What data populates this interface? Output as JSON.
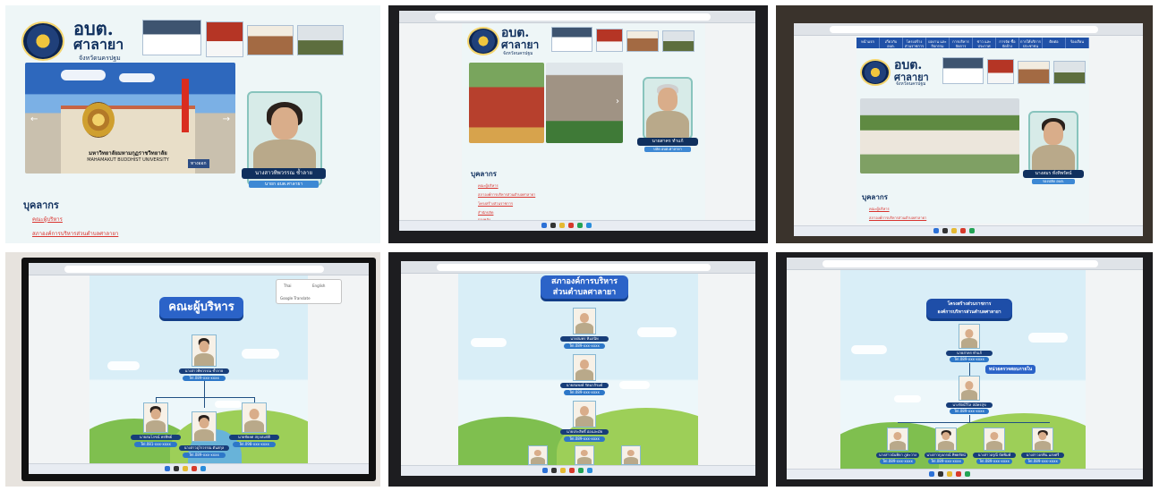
{
  "panels": {
    "p1": {
      "brand_main": "อบต.",
      "brand_name": "ศาลายา",
      "brand_sub": "จังหวัดนครปฐม",
      "university_sign": "มหาวิทยาลัยมหามกุฏราชวิทยาลัย",
      "university_sign_en": "MAHAMAKUT BUDDHIST UNIVERSITY",
      "profile_name": "นางสาวทิพวรรณ ช้ำลาย",
      "profile_role": "นายก อบต.ศาลายา",
      "section_title": "บุคลากร",
      "links": [
        "คณะผู้บริหาร",
        "สภาองค์การบริหารส่วนตำบลศาลายา"
      ],
      "next_arrow": "→",
      "prev_arrow": "←",
      "sign_small": "ทางออก"
    },
    "p2": {
      "brand_main": "อบต.",
      "brand_name": "ศาลายา",
      "brand_sub": "จังหวัดนครปฐม",
      "profile_name": "นายสาคร ทำแก้",
      "profile_role": "ปลัด อบต.ศาลายา",
      "section_title": "บุคลากร",
      "links": [
        "คณะผู้บริหาร",
        "สภาองค์การบริหารส่วนตำบลศาลายา",
        "โครงสร้างส่วนราชการ",
        "สำนักปลัด",
        "กองคลัง"
      ],
      "next_arrow": "›"
    },
    "p3": {
      "brand_main": "อบต.",
      "brand_name": "ศาลายา",
      "brand_sub": "จังหวัดนครปฐม",
      "nav": [
        "หน้าแรก",
        "เกี่ยวกับ อบต.",
        "โครงสร้าง ส่วนราชการ",
        "ผลงาน และ กิจกรรม",
        "การบริหาร จัดการ",
        "ข่าว และ ประกาศ",
        "การจัด ซื้อจัดจ้าง",
        "การให้บริการ ประชาชน",
        "ติดต่อ",
        "ร้องเรียน"
      ],
      "profile_name": "นางสมร ทั่งทิพรัตน์",
      "profile_role": "รองปลัด อบต.",
      "section_title": "บุคลากร",
      "links": [
        "คณะผู้บริหาร",
        "สภาองค์การบริหารส่วนตำบลศาลายา"
      ]
    },
    "p4": {
      "title": "คณะผู้บริหาร",
      "popup_options": [
        "Thai",
        "English"
      ],
      "popup_footer": "Google Translate",
      "top_name": "นางสาวทิพวรรณ ช้ำลาย",
      "top_phone": "Tel.089-xxx-xxxx",
      "members": [
        {
          "name": "นายสมโภชน์ พรทิพย์",
          "phone": "Tel.081-xxx-xxxx"
        },
        {
          "name": "นางสาวอุไรวรรณ ตันสกุล",
          "phone": "Tel.089-xxx-xxxx"
        },
        {
          "name": "นายชัยยศ สกุลสมบัติ",
          "phone": "Tel.098-xxx-xxxx"
        }
      ]
    },
    "p5": {
      "title_line1": "สภาองค์การบริหาร",
      "title_line2": "ส่วนตำบลศาลายา",
      "members": [
        {
          "name": "นายสมพร ทิมสนิท",
          "phone": "Tel.089-xxx-xxxx"
        },
        {
          "name": "นายสมพงษ์ รัตนาภิรมย์",
          "phone": "Tel.089-xxx-xxxx"
        },
        {
          "name": "นายประสิทธิ์ อ่อนละมัย",
          "phone": "Tel.089-xxx-xxxx"
        }
      ]
    },
    "p6": {
      "title_line1": "โครงสร้างส่วนราชการ",
      "title_line2": "องค์การบริหารส่วนตำบลศาลายา",
      "unit_banner": "หน่วยตรวจสอบภายใน",
      "top": {
        "name": "นายสาคร ทำแก้",
        "phone": "Tel.089-xxx-xxxx"
      },
      "second": {
        "name": "นางรัตน์วิไล สมัครสุข",
        "phone": "Tel.089-xxx-xxxx"
      },
      "members": [
        {
          "name": "นางสาวนันทิดา ภูตะวาง",
          "phone": "Tel.089-xxx-xxxx"
        },
        {
          "name": "นางสาวกุลภรณ์ ทิพยรัตน์",
          "phone": "Tel.089-xxx-xxxx"
        },
        {
          "name": "นางสาวอรุณี ปัดพิมพ์",
          "phone": "Tel.089-xxx-xxxx"
        },
        {
          "name": "นางสาวอรพิน แสงศรี",
          "phone": "Tel.089-xxx-xxxx"
        }
      ]
    }
  }
}
